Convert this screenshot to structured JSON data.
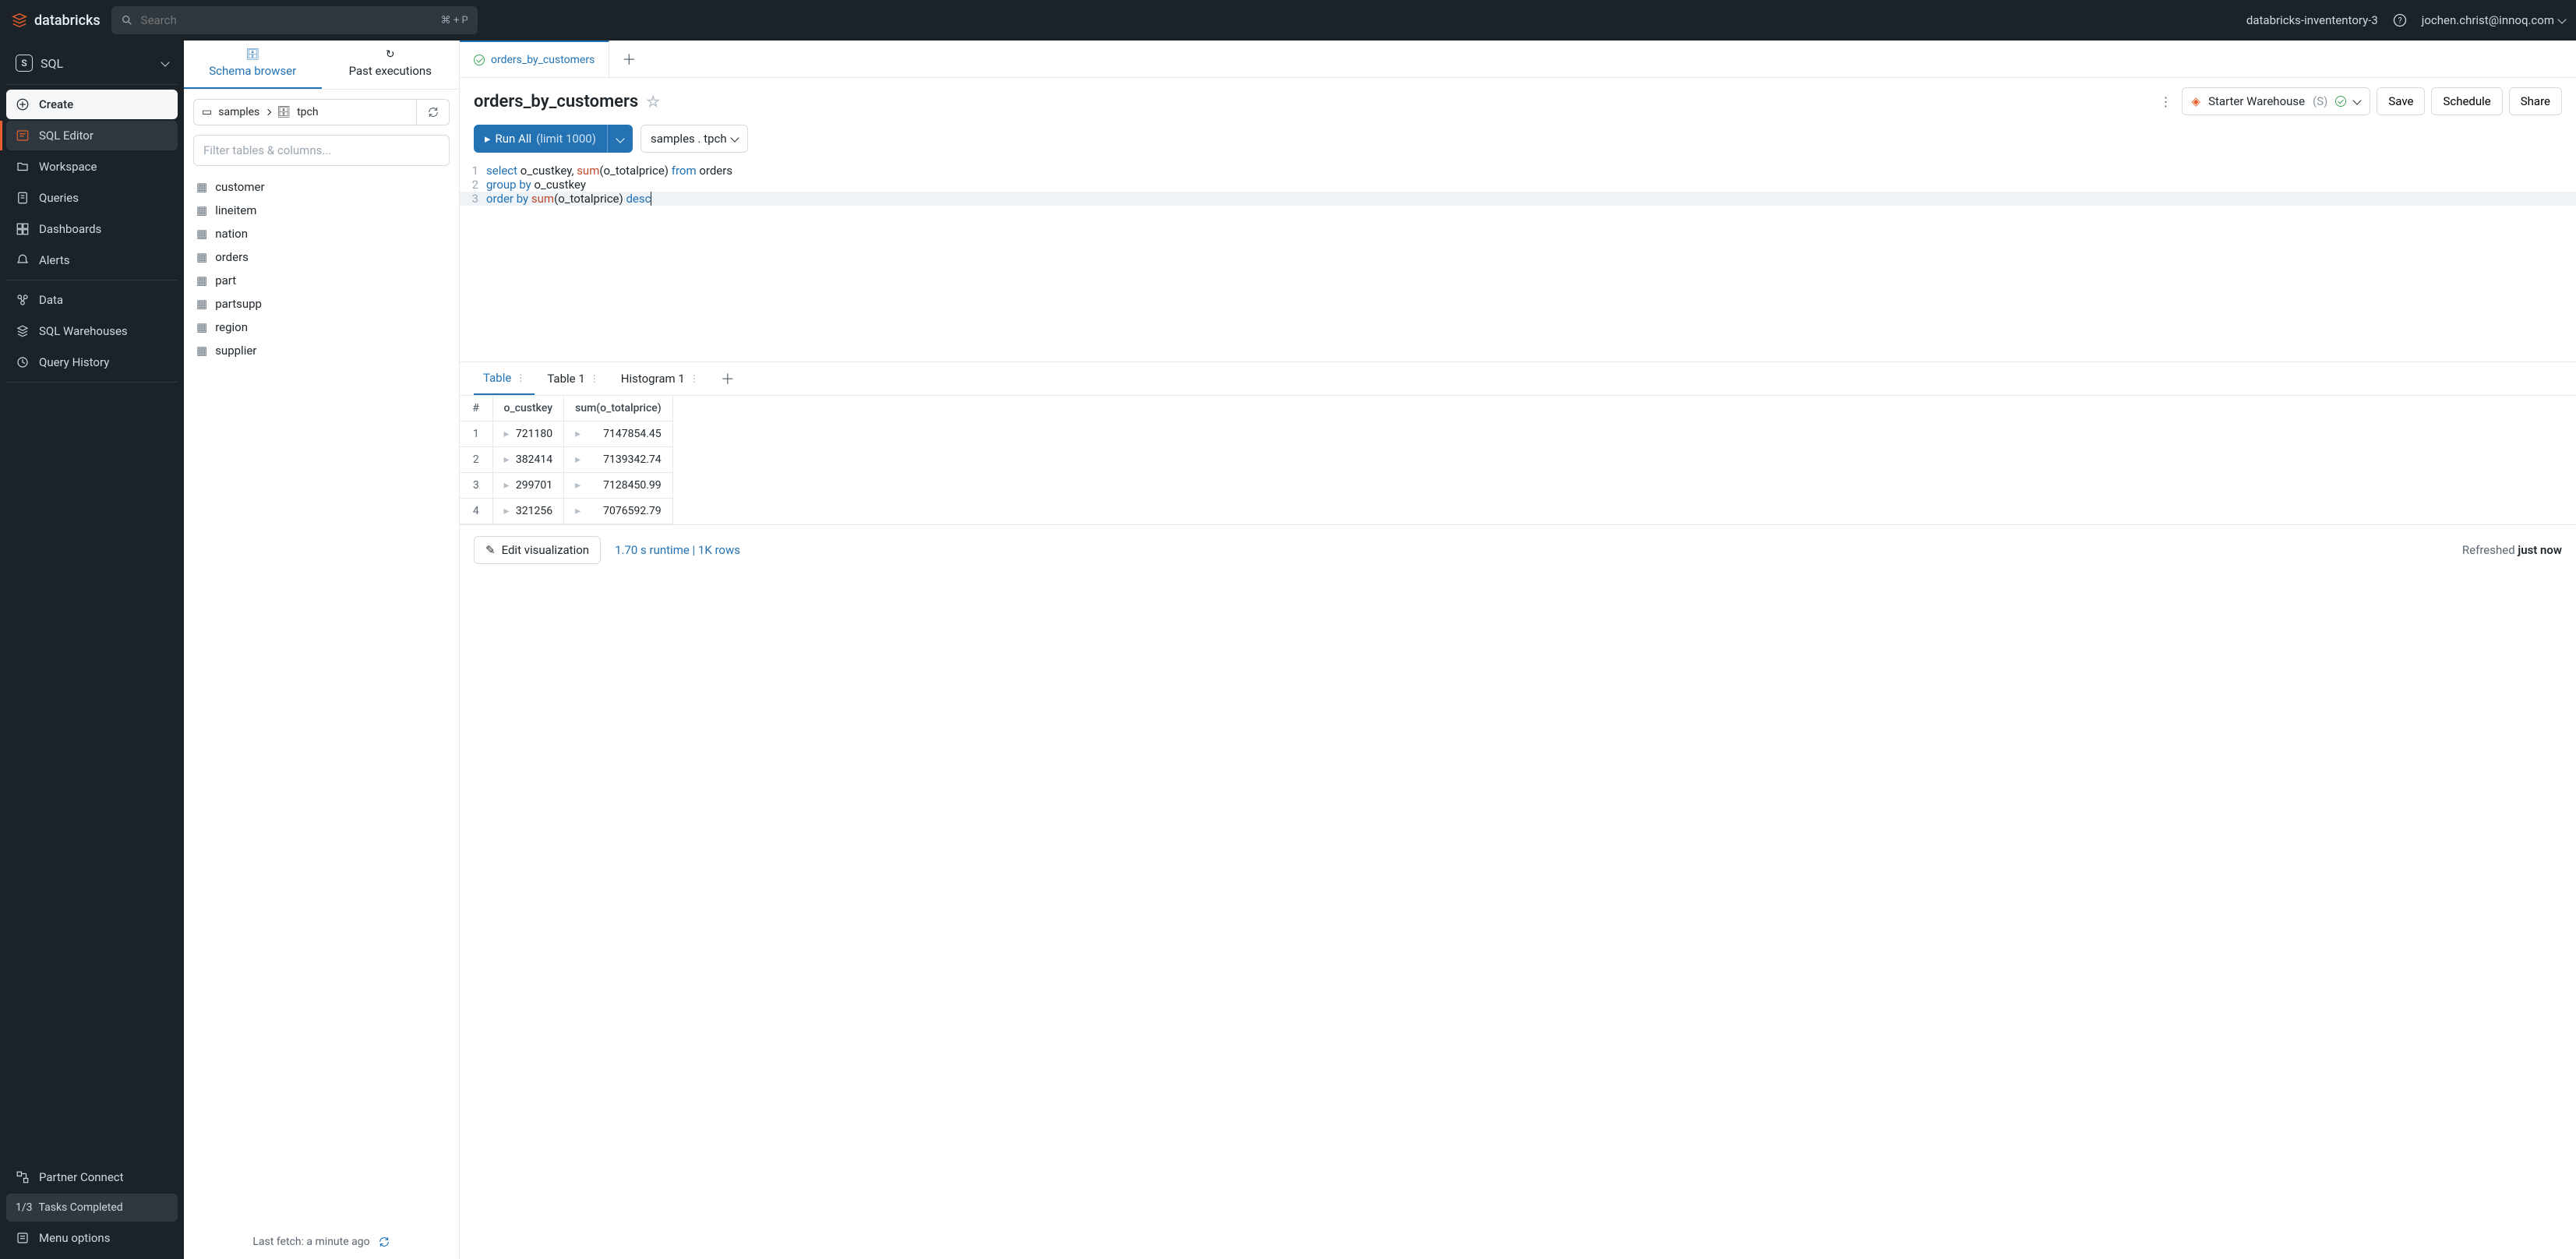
{
  "topbar": {
    "brand": "databricks",
    "search_placeholder": "Search",
    "search_kbd": "⌘ + P",
    "workspace": "databricks-invententory-3",
    "user": "jochen.christ@innoq.com"
  },
  "nav": {
    "persona": "SQL",
    "create": "Create",
    "items": [
      {
        "label": "SQL Editor",
        "icon": "sql-editor-icon",
        "active": true
      },
      {
        "label": "Workspace",
        "icon": "workspace-icon"
      },
      {
        "label": "Queries",
        "icon": "queries-icon"
      },
      {
        "label": "Dashboards",
        "icon": "dashboards-icon"
      },
      {
        "label": "Alerts",
        "icon": "alerts-icon"
      }
    ],
    "items2": [
      {
        "label": "Data",
        "icon": "data-icon"
      },
      {
        "label": "SQL Warehouses",
        "icon": "warehouses-icon"
      },
      {
        "label": "Query History",
        "icon": "history-icon"
      }
    ],
    "items3": [
      {
        "label": "Partner Connect",
        "icon": "partner-icon"
      }
    ],
    "tasks_count": "1/3",
    "tasks_label": "Tasks Completed",
    "menu": "Menu options"
  },
  "browser": {
    "tabs": [
      "Schema browser",
      "Past executions"
    ],
    "active_tab": 0,
    "path": {
      "catalog": "samples",
      "schema": "tpch"
    },
    "filter_placeholder": "Filter tables & columns...",
    "tables": [
      "customer",
      "lineitem",
      "nation",
      "orders",
      "part",
      "partsupp",
      "region",
      "supplier"
    ],
    "last_fetch": "Last fetch: a minute ago"
  },
  "query": {
    "tabs": [
      {
        "name": "orders_by_customers",
        "status": "ok"
      }
    ],
    "title": "orders_by_customers",
    "warehouse": {
      "name": "Starter Warehouse",
      "size": "(S)"
    },
    "actions": {
      "save": "Save",
      "schedule": "Schedule",
      "share": "Share"
    },
    "run_label": "Run All",
    "run_limit": "(limit 1000)",
    "context": "samples . tpch",
    "lines": [
      {
        "n": 1,
        "tokens": [
          [
            "kw",
            "select"
          ],
          [
            "",
            " o_custkey, "
          ],
          [
            "fn",
            "sum"
          ],
          [
            "",
            "(o_totalprice) "
          ],
          [
            "kw",
            "from"
          ],
          [
            "",
            " orders"
          ]
        ]
      },
      {
        "n": 2,
        "tokens": [
          [
            "kw",
            "group by"
          ],
          [
            "",
            " o_custkey"
          ]
        ]
      },
      {
        "n": 3,
        "tokens": [
          [
            "kw",
            "order by"
          ],
          [
            "",
            " "
          ],
          [
            "fn",
            "sum"
          ],
          [
            "",
            "(o_totalprice) "
          ],
          [
            "kw",
            "desc"
          ]
        ]
      }
    ]
  },
  "results": {
    "tabs": [
      "Table",
      "Table 1",
      "Histogram 1"
    ],
    "active_tab": 0,
    "columns": [
      "#",
      "o_custkey",
      "sum(o_totalprice)"
    ],
    "rows": [
      [
        1,
        721180,
        "7147854.45"
      ],
      [
        2,
        382414,
        "7139342.74"
      ],
      [
        3,
        299701,
        "7128450.99"
      ],
      [
        4,
        321256,
        "7076592.79"
      ]
    ],
    "edit_viz": "Edit visualization",
    "runtime": "1.70 s runtime  |  1K rows",
    "refreshed_prefix": "Refreshed ",
    "refreshed_value": "just now"
  }
}
